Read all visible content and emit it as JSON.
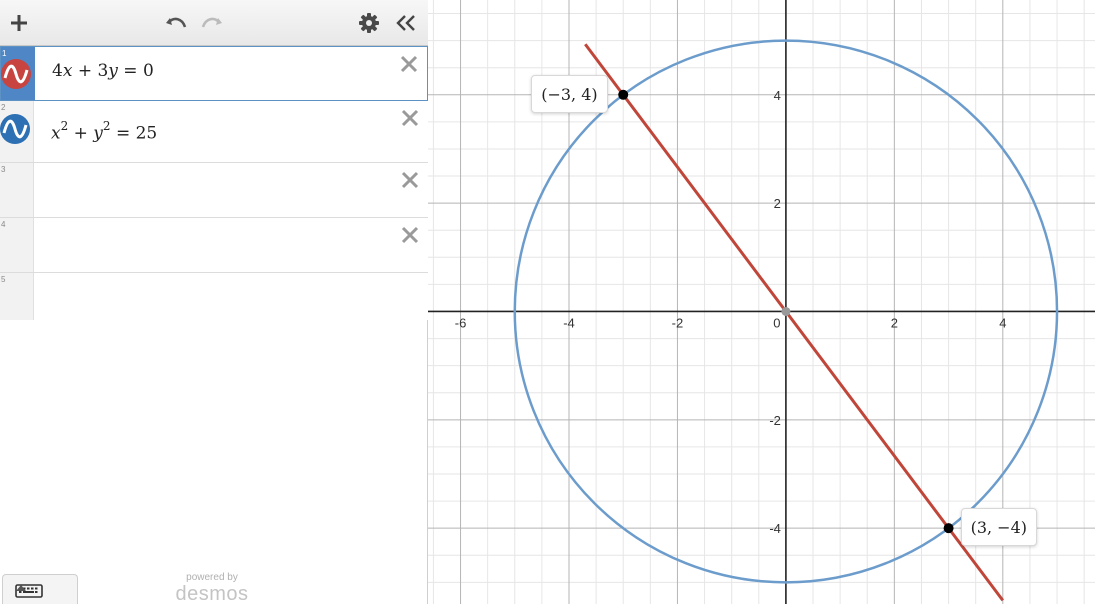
{
  "toolbar": {
    "add_icon": "plus-icon",
    "undo_icon": "undo-icon",
    "redo_icon": "redo-icon",
    "settings_icon": "gear-icon",
    "collapse_icon": "double-chevron-left-icon"
  },
  "expressions": [
    {
      "index": "1",
      "color": "#c74440",
      "latex": [
        "4",
        "x",
        " + 3",
        "y",
        " = 0"
      ],
      "selected": true
    },
    {
      "index": "2",
      "color": "#2d70b3",
      "latex": [
        "x",
        "2",
        " + ",
        "y",
        "2",
        " = 25"
      ],
      "selected": false
    },
    {
      "index": "3"
    },
    {
      "index": "4"
    },
    {
      "index": "5"
    }
  ],
  "footer": {
    "powered_by": "powered by",
    "brand": "desmos"
  },
  "graph": {
    "colors": {
      "line": "#c0463a",
      "circle": "#6c9ccc",
      "point": "#000000",
      "origin": "#999999"
    },
    "xlim": [
      -6.6,
      5.7
    ],
    "ylim": [
      -5.4,
      5.75
    ],
    "x_ticks": [
      "-6",
      "-4",
      "-2",
      "0",
      "2",
      "4"
    ],
    "y_ticks": [
      "4",
      "2",
      "-2",
      "-4"
    ],
    "points": [
      {
        "x": -3,
        "y": 4,
        "label": "(−3, 4)"
      },
      {
        "x": 3,
        "y": -4,
        "label": "(3, −4)"
      }
    ],
    "curves": [
      {
        "type": "line",
        "equation": "4x + 3y = 0"
      },
      {
        "type": "circle",
        "equation": "x^2 + y^2 = 25",
        "radius": 5
      }
    ]
  }
}
